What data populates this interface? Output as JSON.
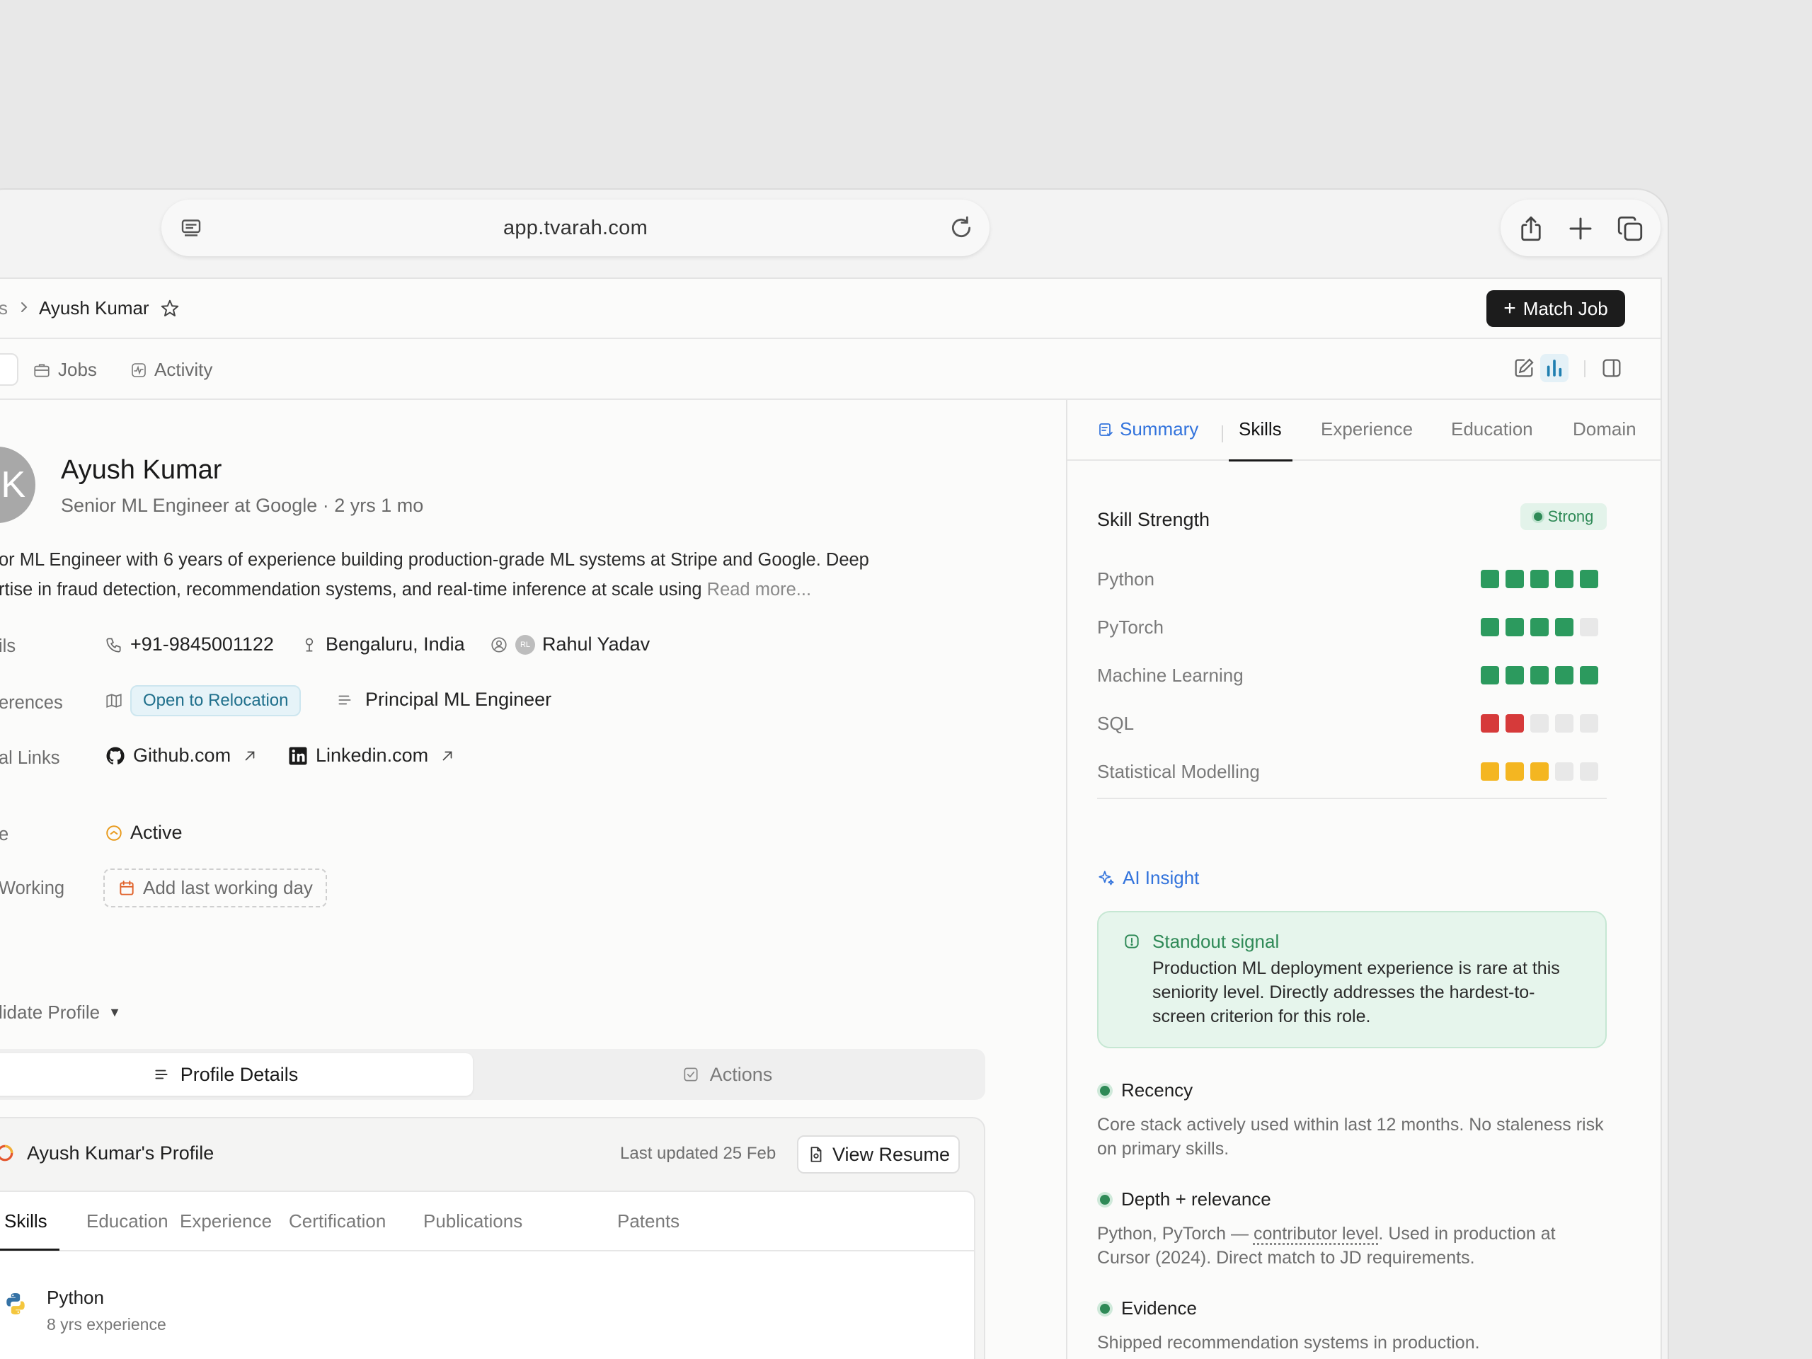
{
  "browser": {
    "url": "app.tvarah.com"
  },
  "header": {
    "breadcrumb_prev": "s",
    "breadcrumb_current": "Ayush Kumar",
    "match_job_label": "Match Job"
  },
  "nav_tabs": {
    "jobs": "Jobs",
    "activity": "Activity"
  },
  "candidate": {
    "avatar_initial": "K",
    "name": "Ayush Kumar",
    "role": "Senior ML Engineer at Google · 2 yrs 1 mo",
    "bio_line1": "or ML Engineer with 6 years of experience building production-grade ML systems at Stripe and Google. Deep",
    "bio_line2": "rtise in fraud detection, recommendation systems, and real-time inference at scale using ",
    "read_more": "Read more..."
  },
  "details": {
    "contact_label": "ils",
    "phone": "+91-9845001122",
    "location": "Bengaluru, India",
    "recruiter_initials": "RL",
    "recruiter": "Rahul Yadav",
    "preferences_label": "erences",
    "relocation_chip": "Open to Relocation",
    "target_role": "Principal ML Engineer",
    "links_label": "al Links",
    "github": "Github.com",
    "linkedin": "Linkedin.com",
    "status_label": "e",
    "status": "Active",
    "working_label": "Working",
    "last_working_day": "Add last working day"
  },
  "profile_section": {
    "collapse_label": "lidate Profile",
    "seg_profile": "Profile Details",
    "seg_actions": "Actions",
    "card_title": "Ayush Kumar's Profile",
    "last_updated": "Last updated 25 Feb",
    "view_resume": "View Resume",
    "tabs": [
      "Skills",
      "Education",
      "Experience",
      "Certification",
      "Publications",
      "Patents"
    ],
    "skill_name": "Python",
    "skill_exp": "8 yrs experience"
  },
  "right_panel": {
    "tabs": [
      "Summary",
      "Skills",
      "Experience",
      "Education",
      "Domain"
    ],
    "strength_title": "Skill Strength",
    "strength_badge": "Strong",
    "skills": [
      {
        "name": "Python",
        "level": 5,
        "color": "#2c9a5e"
      },
      {
        "name": "PyTorch",
        "level": 4,
        "color": "#2c9a5e"
      },
      {
        "name": "Machine Learning",
        "level": 5,
        "color": "#2c9a5e"
      },
      {
        "name": "SQL",
        "level": 2,
        "color": "#d63a3a"
      },
      {
        "name": "Statistical Modelling",
        "level": 3,
        "color": "#f4b621"
      }
    ],
    "empty_color": "#e8e8e8",
    "ai_insight_title": "AI Insight",
    "insight_title": "Standout signal",
    "insight_text": "Production ML deployment experience is rare at this seniority level. Directly addresses the hardest-to-screen criterion for this role.",
    "signals": [
      {
        "title": "Recency",
        "text": "Core stack actively used within last 12 months. No staleness risk on primary skills."
      },
      {
        "title": "Depth + relevance",
        "text_pre": "Python, PyTorch — ",
        "text_link": "contributor level",
        "text_post": ". Used in production at Cursor (2024). Direct match to JD requirements."
      },
      {
        "title": "Evidence",
        "text": "Shipped recommendation systems in production."
      }
    ]
  }
}
